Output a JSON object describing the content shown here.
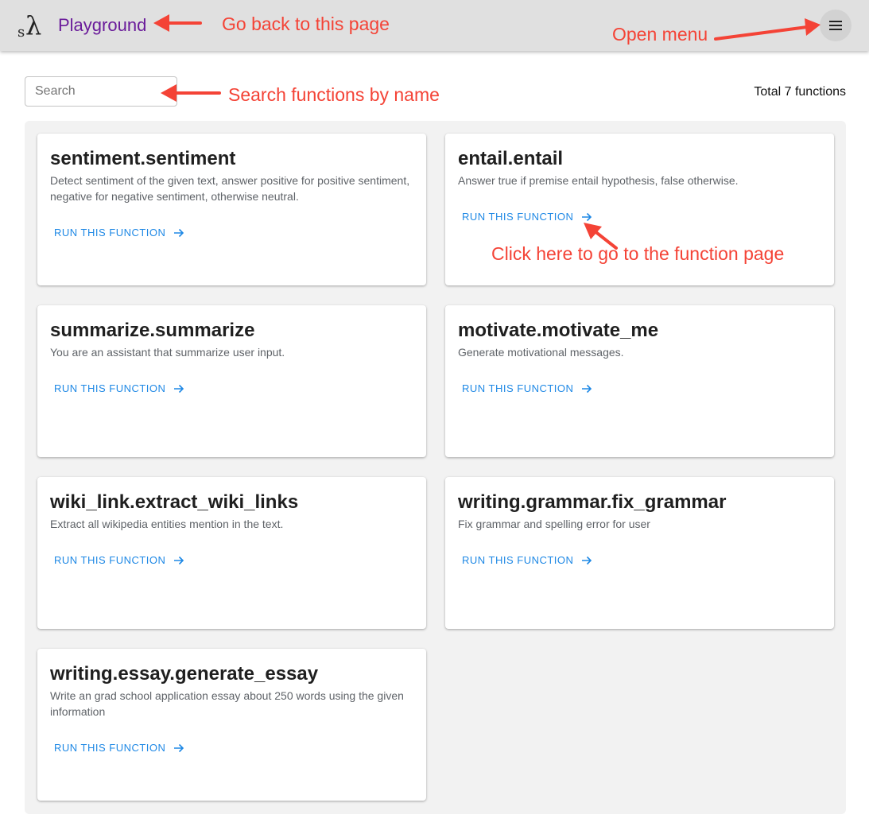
{
  "appbar": {
    "logo": {
      "small": "s",
      "large": "λ"
    },
    "title": "Playground",
    "menu_icon": "hamburger-menu-icon"
  },
  "toolbar": {
    "search": {
      "placeholder": "Search",
      "value": ""
    },
    "total_text": "Total 7 functions"
  },
  "cards": [
    {
      "title": "sentiment.sentiment",
      "description": "Detect sentiment of the given text, answer positive for positive sentiment, negative for negative sentiment, otherwise neutral.",
      "action": "RUN THIS FUNCTION"
    },
    {
      "title": "entail.entail",
      "description": "Answer true if premise entail hypothesis, false otherwise.",
      "action": "RUN THIS FUNCTION"
    },
    {
      "title": "summarize.summarize",
      "description": "You are an assistant that summarize user input.",
      "action": "RUN THIS FUNCTION"
    },
    {
      "title": "motivate.motivate_me",
      "description": "Generate motivational messages.",
      "action": "RUN THIS FUNCTION"
    },
    {
      "title": "wiki_link.extract_wiki_links",
      "description": "Extract all wikipedia entities mention in the text.",
      "action": "RUN THIS FUNCTION"
    },
    {
      "title": "writing.grammar.fix_grammar",
      "description": "Fix grammar and spelling error for user",
      "action": "RUN THIS FUNCTION"
    },
    {
      "title": "writing.essay.generate_essay",
      "description": "Write an grad school application essay about 250 words using the given information",
      "action": "RUN THIS FUNCTION"
    }
  ],
  "annotations": {
    "go_back": "Go back to this page",
    "open_menu": "Open menu",
    "search": "Search functions by name",
    "click_here": "Click here to go to the function page",
    "color": "#f44336"
  },
  "colors": {
    "appbar": "#e0e0e0",
    "title": "#6a1b9a",
    "link": "#1e88e5",
    "panel": "#f2f2f2"
  }
}
